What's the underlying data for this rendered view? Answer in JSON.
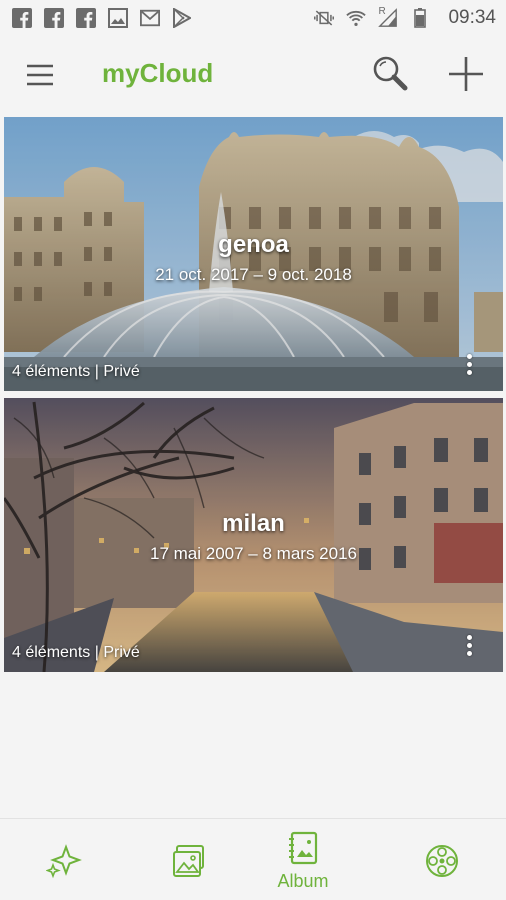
{
  "status_bar": {
    "left_icons": [
      "facebook-icon",
      "facebook-icon",
      "facebook-icon",
      "image-icon",
      "gmail-icon",
      "play-store-icon"
    ],
    "right_icons": [
      "vibrate-off-icon",
      "wifi-icon",
      "signal-icon",
      "battery-icon"
    ],
    "signal_letter": "R",
    "time": "09:34"
  },
  "app_bar": {
    "title": "myCloud",
    "menu_icon": "menu-icon",
    "search_icon": "search-icon",
    "add_icon": "plus-icon"
  },
  "albums": [
    {
      "name": "genoa",
      "dates": "21 oct. 2017 – 9 oct. 2018",
      "meta": "4 éléments | Privé"
    },
    {
      "name": "milan",
      "dates": "17 mai 2007 – 8 mars 2016",
      "meta": "4 éléments | Privé"
    }
  ],
  "bottom_nav": {
    "items": [
      {
        "icon": "sparkle-icon",
        "label": ""
      },
      {
        "icon": "photos-icon",
        "label": ""
      },
      {
        "icon": "album-icon",
        "label": "Album",
        "active": true
      },
      {
        "icon": "film-reel-icon",
        "label": ""
      }
    ]
  },
  "colors": {
    "accent": "#6fb33c",
    "background": "#f4f4f4",
    "icon_gray": "#555555"
  }
}
